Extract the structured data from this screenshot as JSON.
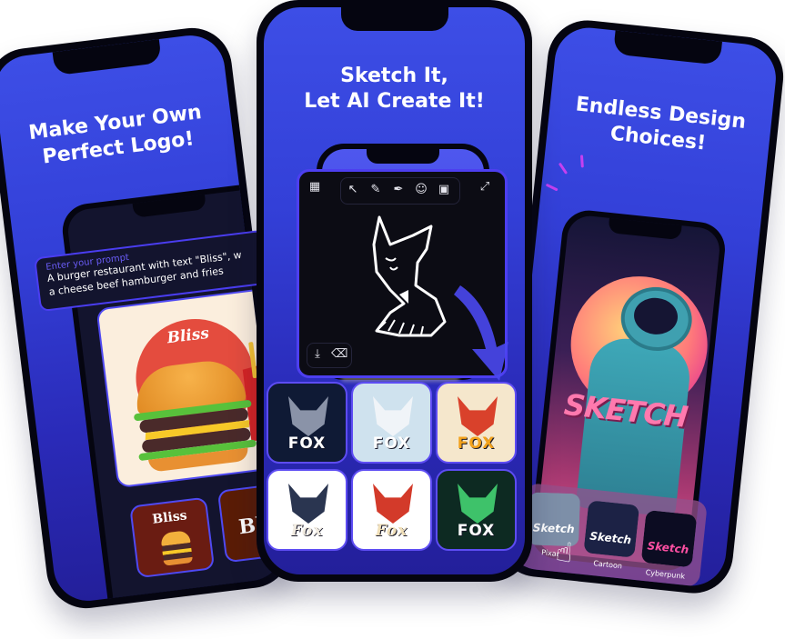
{
  "phones": {
    "left": {
      "headline_line1": "Make Your Own",
      "headline_line2": "Perfect Logo!",
      "prompt": {
        "label": "Enter your prompt",
        "text_line1": "A burger restaurant with text \"Bliss\", w",
        "text_line2": "a cheese beef hamburger and fries"
      },
      "hero_logo_text": "Bliss",
      "thumbnails": [
        {
          "text": "Bliss",
          "bg": "#6a1c12"
        },
        {
          "text": "Blis",
          "bg": "#5a1c06"
        }
      ]
    },
    "center": {
      "headline_line1": "Sketch It,",
      "headline_line2": "Let AI Create It!",
      "toolbar": {
        "grid_icon": "▦",
        "select_icon": "↖",
        "pencil_icon": "✎",
        "pen_icon": "✒",
        "emoji_icon": "☺",
        "image_icon": "▣",
        "fullscreen_icon": "⤢",
        "download_icon": "⤓",
        "clear_icon": "⌫"
      },
      "results": [
        {
          "text": "FOX",
          "bg": "#0f1a35",
          "color": "#ffffff",
          "head": "#8a93a8"
        },
        {
          "text": "FOX",
          "bg": "#cfe2ee",
          "color": "#ffffff",
          "head": "#f0f4f8"
        },
        {
          "text": "FOX",
          "bg": "#f5e7cc",
          "color": "#f3a21b",
          "head": "#d9412b"
        },
        {
          "text": "Fox",
          "bg": "#ffffff",
          "color": "#f1ebe0",
          "head": "#2a3550"
        },
        {
          "text": "Fox",
          "bg": "#ffffff",
          "color": "#f0dfb8",
          "head": "#d33a2a"
        },
        {
          "text": "FOX",
          "bg": "#0d2a22",
          "color": "#ffffff",
          "head": "#3ec26a"
        }
      ]
    },
    "right": {
      "headline_line1": "Endless Design",
      "headline_line2": "Choices!",
      "hero_text": "SKETCH",
      "styles": [
        {
          "label": "Pixar",
          "word": "Sketch",
          "bg": "#7d8fa8",
          "color": "#ffffff"
        },
        {
          "label": "Cartoon",
          "word": "Sketch",
          "bg": "#1c2245",
          "color": "#ffffff"
        },
        {
          "label": "Cyberpunk",
          "word": "Sketch",
          "bg": "#0c0c22",
          "color": "#ff4fa3"
        }
      ]
    }
  },
  "colors": {
    "accent": "#4d3ff0",
    "highlight": "#d22ff0",
    "screen_top": "#3d4ee6",
    "screen_bottom": "#231f9a"
  }
}
